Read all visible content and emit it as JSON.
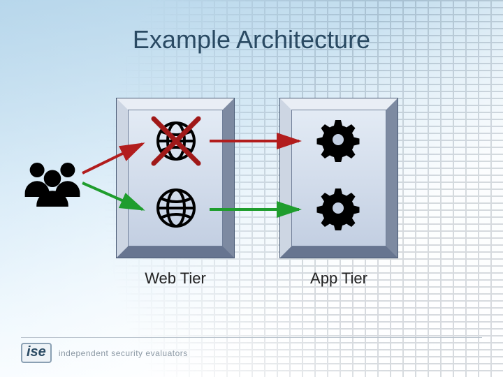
{
  "title": "Example Architecture",
  "tiers": {
    "web": {
      "label": "Web Tier"
    },
    "app": {
      "label": "App Tier"
    }
  },
  "footer": {
    "logo_text": "ise",
    "tagline": "independent security evaluators"
  },
  "colors": {
    "title": "#2a4a63",
    "arrow_red": "#b21d1d",
    "arrow_green": "#1f9d2d",
    "x_mark": "#a01818"
  },
  "diagram": {
    "nodes": {
      "users": {
        "kind": "users-group"
      },
      "web1": {
        "kind": "globe",
        "status": "down"
      },
      "web2": {
        "kind": "globe",
        "status": "up"
      },
      "app1": {
        "kind": "gear"
      },
      "app2": {
        "kind": "gear"
      }
    },
    "edges": [
      {
        "from": "users",
        "to": "web1",
        "color": "red"
      },
      {
        "from": "users",
        "to": "web2",
        "color": "green"
      },
      {
        "from": "web1",
        "to": "app1",
        "color": "red"
      },
      {
        "from": "web2",
        "to": "app2",
        "color": "green"
      }
    ]
  }
}
